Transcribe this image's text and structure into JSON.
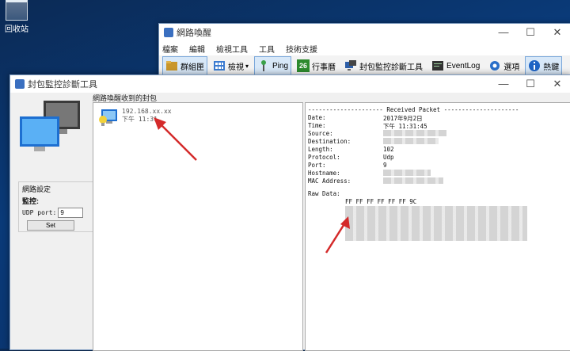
{
  "desktop": {
    "recycle_bin_label": "回收站"
  },
  "back_window": {
    "title": "網路喚醒",
    "controls": {
      "minimize": "—",
      "maximize": "☐",
      "close": "✕"
    },
    "menu": [
      "檔案",
      "編輯",
      "檢視工具",
      "工具",
      "技術支援"
    ],
    "toolbar": [
      {
        "label": "群組匣",
        "icon": "folder-icon"
      },
      {
        "label": "檢視",
        "icon": "grid-icon"
      },
      {
        "label": "Ping",
        "icon": "ping-icon"
      },
      {
        "label": "行事曆",
        "icon": "calendar-icon",
        "icon_text": "26"
      },
      {
        "label": "封包監控診斷工具",
        "icon": "monitor-icon"
      },
      {
        "label": "EventLog",
        "icon": "eventlog-icon"
      },
      {
        "label": "選項",
        "icon": "gear-icon"
      },
      {
        "label": "熱鍵",
        "icon": "info-icon"
      }
    ]
  },
  "front_window": {
    "title": "封包監控診斷工具",
    "controls": {
      "minimize": "—",
      "maximize": "☐",
      "close": "✕"
    },
    "settings": {
      "group_label": "網路設定",
      "monitor_label": "監控:",
      "udp_port_label": "UDP port:",
      "udp_port_value": "9",
      "set_button": "Set"
    },
    "list_label": "網路喚醒收到的封包",
    "list_items": [
      {
        "line1": "192.168.xx.xx",
        "line2": "下午 11:31"
      }
    ],
    "detail": {
      "header": "--------------------- Received Packet ---------------------",
      "fields": [
        {
          "label": "Date:",
          "value": "2017年9月2日"
        },
        {
          "label": "Time:",
          "value": "下午 11:31:45"
        },
        {
          "label": "Source:",
          "value": ""
        },
        {
          "label": "Destination:",
          "value": ""
        },
        {
          "label": "Length:",
          "value": "102"
        },
        {
          "label": "Protocol:",
          "value": "Udp"
        },
        {
          "label": "Port:",
          "value": "9"
        },
        {
          "label": "Hostname:",
          "value": ""
        },
        {
          "label": "MAC Address:",
          "value": ""
        }
      ],
      "raw_label": "Raw Data:",
      "raw_first": "FF FF FF FF FF FF 9C"
    }
  },
  "colors": {
    "accent": "#d42a2a",
    "selection": "#d8e8f8",
    "desktop": "#0a3a78"
  }
}
